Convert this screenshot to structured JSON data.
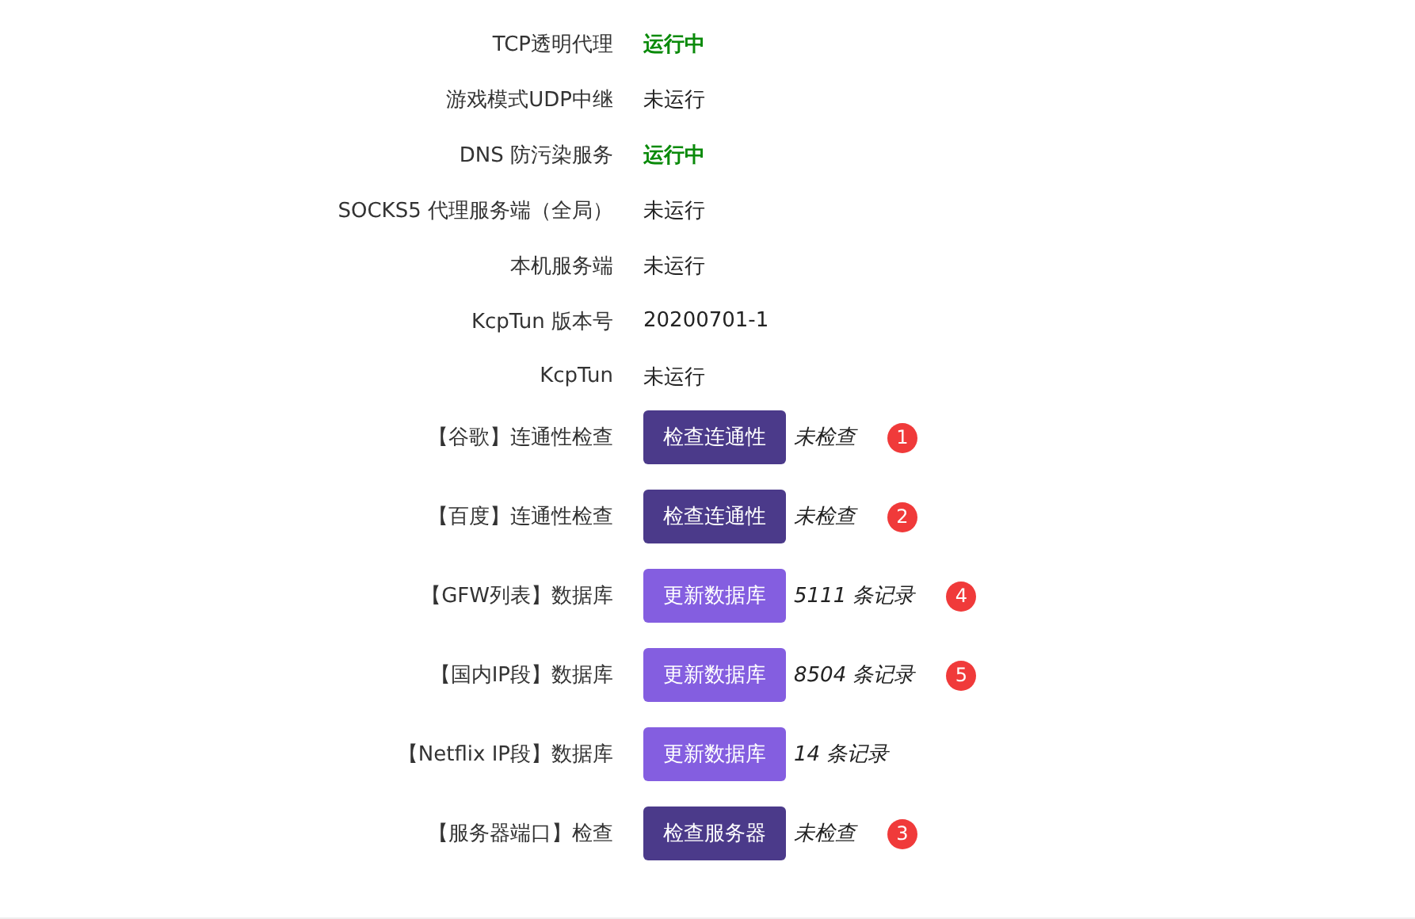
{
  "status_rows": [
    {
      "label": "TCP透明代理",
      "value": "运行中",
      "kind": "running"
    },
    {
      "label": "游戏模式UDP中继",
      "value": "未运行",
      "kind": "plain"
    },
    {
      "label": "DNS 防污染服务",
      "value": "运行中",
      "kind": "running"
    },
    {
      "label": "SOCKS5 代理服务端（全局）",
      "value": "未运行",
      "kind": "plain"
    },
    {
      "label": "本机服务端",
      "value": "未运行",
      "kind": "plain"
    },
    {
      "label": "KcpTun 版本号",
      "value": "20200701-1",
      "kind": "plain"
    },
    {
      "label": "KcpTun",
      "value": "未运行",
      "kind": "plain"
    }
  ],
  "action_rows": [
    {
      "label": "【谷歌】连通性检查",
      "button": "检查连通性",
      "kind": "check",
      "result": "未检查",
      "badge": "1"
    },
    {
      "label": "【百度】连通性检查",
      "button": "检查连通性",
      "kind": "check",
      "result": "未检查",
      "badge": "2"
    },
    {
      "label": "【GFW列表】数据库",
      "button": "更新数据库",
      "kind": "update",
      "result": "5111 条记录",
      "badge": "4"
    },
    {
      "label": "【国内IP段】数据库",
      "button": "更新数据库",
      "kind": "update",
      "result": "8504 条记录",
      "badge": "5"
    },
    {
      "label": "【Netflix IP段】数据库",
      "button": "更新数据库",
      "kind": "update",
      "result": "14 条记录"
    },
    {
      "label": "【服务器端口】检查",
      "button": "检查服务器",
      "kind": "check",
      "result": "未检查",
      "badge": "3"
    }
  ]
}
